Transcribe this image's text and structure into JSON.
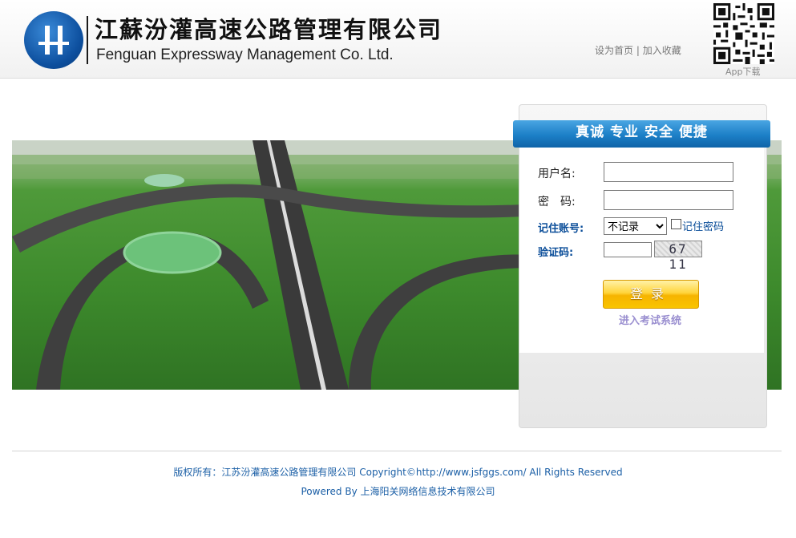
{
  "header": {
    "cn_name": "江蘇汾灌高速公路管理有限公司",
    "en_name": "Fenguan Expressway Management Co. Ltd.",
    "links": [
      "设为首页",
      "加入收藏"
    ],
    "link_separator": "|",
    "qr_label": "App下载"
  },
  "login": {
    "slogan": "真诚 专业 安全 便捷",
    "username_label": "用户名:",
    "password_label": "密　码:",
    "remember_label": "记住账号:",
    "remember_option": "不记录",
    "remember_password_label": "记住密码",
    "captcha_label": "验证码:",
    "captcha_text": "67 11",
    "submit_label": "登录",
    "exam_link": "进入考试系统"
  },
  "footer": {
    "line1": "版权所有：江苏汾灌高速公路管理有限公司 Copyright©http://www.jsfggs.com/ All Rights Reserved",
    "line2": "Powered By 上海阳关网络信息技术有限公司"
  },
  "colors": {
    "title_blue": "#1c7fc7",
    "label_blue": "#0a4d99",
    "button_yellow": "#ffd43a",
    "footer_blue": "#1b5fa6"
  }
}
